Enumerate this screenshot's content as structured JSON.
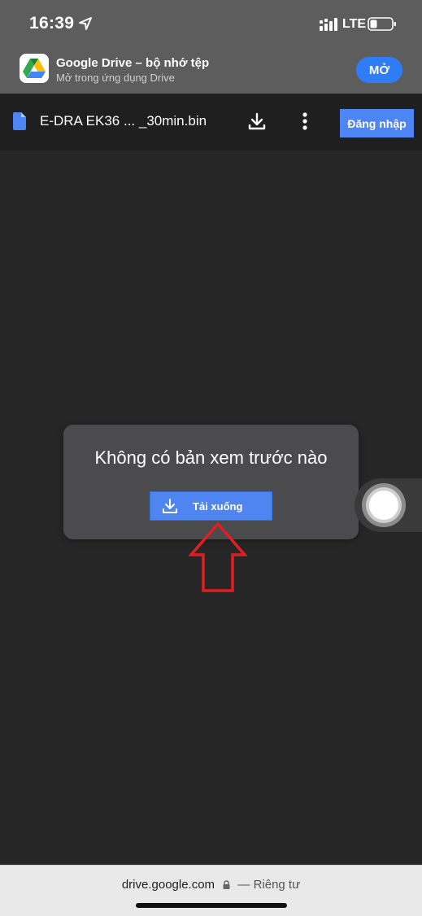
{
  "status_bar": {
    "time": "16:39",
    "network": "LTE"
  },
  "app_banner": {
    "title": "Google Drive – bộ nhớ tệp",
    "subtitle": "Mở trong ứng dụng Drive",
    "open_label": "MỞ"
  },
  "toolbar": {
    "file_name": "E-DRA EK36 ... _30min.bin",
    "signin_label": "Đăng nhập"
  },
  "preview": {
    "message": "Không có bản xem trước nào",
    "download_label": "Tải xuống"
  },
  "address_bar": {
    "url": "drive.google.com",
    "privacy": "— Riêng tư"
  },
  "colors": {
    "accent": "#4e85f1",
    "open_button": "#2f7df6",
    "annotation_arrow": "#e02020",
    "background": "#262626"
  },
  "icons": [
    "location-arrow-icon",
    "signal-icon",
    "battery-icon",
    "google-drive-logo",
    "file-icon",
    "download-icon",
    "more-vert-icon",
    "lock-icon"
  ]
}
